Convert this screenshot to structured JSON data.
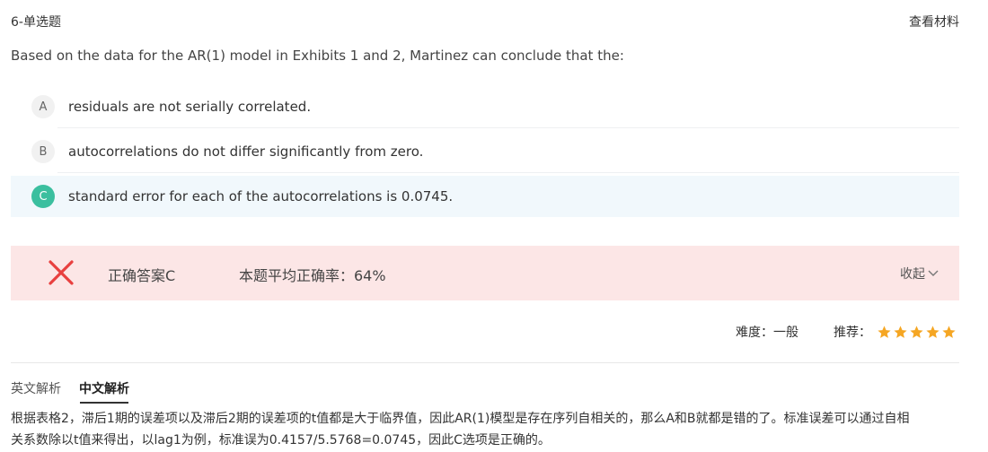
{
  "header": {
    "question_type": "6-单选题",
    "view_material": "查看材料"
  },
  "question": {
    "stem": "Based on the data for the AR(1) model in Exhibits 1 and 2, Martinez can conclude that the:",
    "options": [
      {
        "letter": "A",
        "text": "residuals are not serially correlated.",
        "selected": false
      },
      {
        "letter": "B",
        "text": "autocorrelations do not differ significantly from zero.",
        "selected": false
      },
      {
        "letter": "C",
        "text": "standard error for each of the autocorrelations is 0.0745.",
        "selected": true
      }
    ]
  },
  "result": {
    "status_icon": "x-icon",
    "correct_answer": "正确答案C",
    "accuracy": "本题平均正确率：64%",
    "collapse": "收起",
    "colors": {
      "bar": "#fce6e6",
      "x": "#e8403f"
    }
  },
  "meta": {
    "difficulty": "难度：一般",
    "recommend_label": "推荐：",
    "recommend_stars": 5,
    "star_color": "#f5a623"
  },
  "tabs": [
    {
      "label": "英文解析",
      "active": false
    },
    {
      "label": "中文解析",
      "active": true
    }
  ],
  "analysis": {
    "line1": "根据表格2，滞后1期的误差项以及滞后2期的误差项的t值都是大于临界值，因此AR(1)模型是存在序列自相关的，那么A和B就都是错的了。标准误差可以通过自相",
    "line2": "关系数除以t值来得出，以lag1为例，标准误为0.4157/5.5768=0.0745，因此C选项是正确的。"
  }
}
